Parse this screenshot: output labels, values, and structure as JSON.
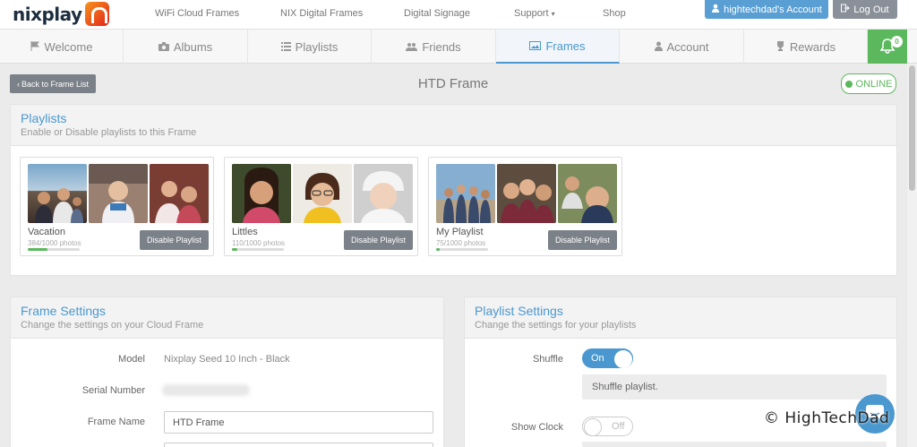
{
  "brand": {
    "name": "nixplay"
  },
  "topnav": {
    "links": [
      "WiFi Cloud Frames",
      "NIX Digital Frames",
      "Digital Signage",
      "Support",
      "Shop"
    ],
    "account_label": "hightechdad's Account",
    "logout_label": "Log Out"
  },
  "tabs": [
    {
      "label": "Welcome",
      "icon": "flag-icon"
    },
    {
      "label": "Albums",
      "icon": "camera-icon"
    },
    {
      "label": "Playlists",
      "icon": "list-icon"
    },
    {
      "label": "Friends",
      "icon": "users-icon"
    },
    {
      "label": "Frames",
      "icon": "picture-icon",
      "active": true
    },
    {
      "label": "Account",
      "icon": "user-icon"
    },
    {
      "label": "Rewards",
      "icon": "trophy-icon"
    }
  ],
  "notifications": {
    "count": "0"
  },
  "header": {
    "back_label": "Back to Frame List",
    "frame_title": "HTD Frame",
    "status": "ONLINE"
  },
  "playlists_panel": {
    "title": "Playlists",
    "subtitle": "Enable or Disable playlists to this Frame",
    "cards": [
      {
        "name": "Vacation",
        "count": "384/1000 photos",
        "progress": 0.384,
        "button": "Disable Playlist"
      },
      {
        "name": "Littles",
        "count": "110/1000 photos",
        "progress": 0.11,
        "button": "Disable Playlist"
      },
      {
        "name": "My Playlist",
        "count": "75/1000 photos",
        "progress": 0.075,
        "button": "Disable Playlist"
      }
    ]
  },
  "frame_settings": {
    "title": "Frame Settings",
    "subtitle": "Change the settings on your Cloud Frame",
    "model_label": "Model",
    "model_value": "Nixplay Seed 10 Inch - Black",
    "serial_label": "Serial Number",
    "name_label": "Frame Name",
    "name_value": "HTD Frame"
  },
  "playlist_settings": {
    "title": "Playlist Settings",
    "subtitle": "Change the settings for your playlists",
    "shuffle_label": "Shuffle",
    "shuffle_state": "On",
    "shuffle_help": "Shuffle playlist.",
    "clock_label": "Show Clock",
    "clock_state": "Off"
  },
  "watermark": "© HighTechDad",
  "colors": {
    "accent": "#4a98cf",
    "success": "#5cb85c",
    "button_gray": "#7b8189"
  }
}
